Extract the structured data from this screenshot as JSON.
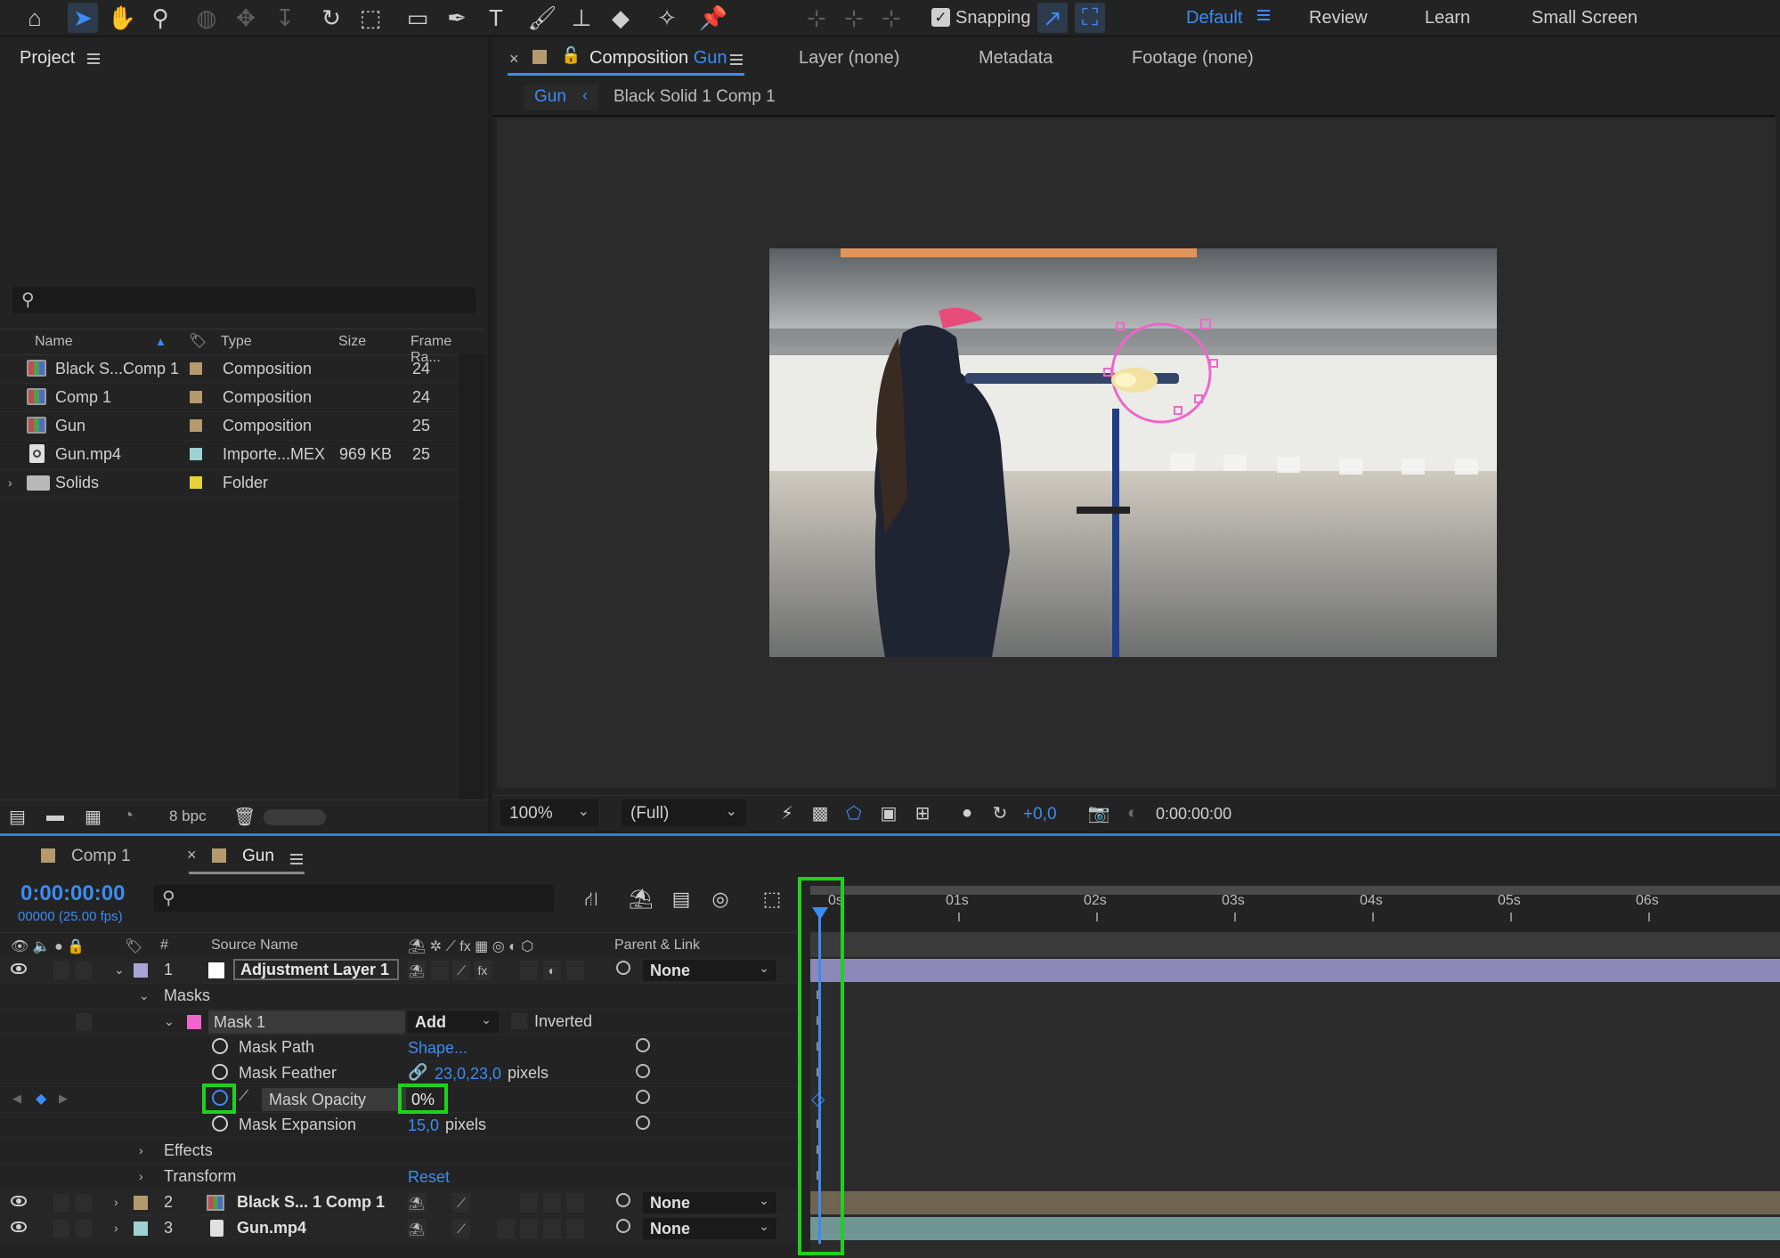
{
  "toolbar": {
    "snapping_label": "Snapping",
    "workspaces": [
      "Default",
      "Review",
      "Learn",
      "Small Screen"
    ],
    "active_workspace": "Default"
  },
  "project": {
    "title": "Project",
    "search_placeholder": "",
    "columns": {
      "name": "Name",
      "type": "Type",
      "size": "Size",
      "frame_rate": "Frame Ra..."
    },
    "items": [
      {
        "name": "Black S...Comp 1",
        "type": "Composition",
        "size": "",
        "frame_rate": "24",
        "icon": "composition-icon",
        "label_color": "#b59a6e"
      },
      {
        "name": "Comp 1",
        "type": "Composition",
        "size": "",
        "frame_rate": "24",
        "icon": "composition-icon",
        "label_color": "#b59a6e"
      },
      {
        "name": "Gun",
        "type": "Composition",
        "size": "",
        "frame_rate": "25",
        "icon": "composition-icon",
        "label_color": "#b59a6e"
      },
      {
        "name": "Gun.mp4",
        "type": "Importe...MEX",
        "size": "969 KB",
        "frame_rate": "25",
        "icon": "footage-icon",
        "label_color": "#9ed2d2"
      },
      {
        "name": "Solids",
        "type": "Folder",
        "size": "",
        "frame_rate": "",
        "icon": "folder-icon",
        "label_color": "#e6d23a"
      }
    ],
    "bit_depth": "8 bpc"
  },
  "composition_panel": {
    "tab_prefix": "Composition",
    "tab_name": "Gun",
    "other_tabs": [
      "Layer (none)",
      "Metadata",
      "Footage (none)"
    ],
    "breadcrumb": [
      "Gun",
      "Black Solid 1 Comp 1"
    ],
    "zoom": "100%",
    "resolution": "(Full)",
    "exposure": "+0,0",
    "timecode": "0:00:00:00"
  },
  "timeline": {
    "tabs": [
      "Comp 1",
      "Gun"
    ],
    "active_tab": "Gun",
    "current_time": "0:00:00:00",
    "frame_info": "00000 (25.00 fps)",
    "columns": {
      "number": "#",
      "source_name": "Source Name",
      "parent": "Parent & Link"
    },
    "ruler_labels": [
      "0s",
      "01s",
      "02s",
      "03s",
      "04s",
      "05s",
      "06s"
    ],
    "layers": [
      {
        "number": "1",
        "name": "Adjustment Layer 1",
        "parent": "None",
        "label_color": "#a9a4d6",
        "swatch_color": "#ffffff",
        "track_color": "#8c88b8"
      },
      {
        "number": "2",
        "name": "Black S... 1 Comp 1",
        "parent": "None",
        "label_color": "#b59a6e",
        "track_color": "#6e6451"
      },
      {
        "number": "3",
        "name": "Gun.mp4",
        "parent": "None",
        "label_color": "#9ed2d2",
        "track_color": "#6f9595"
      }
    ],
    "masks_group": "Masks",
    "mask": {
      "name": "Mask 1",
      "mode": "Add",
      "inverted_label": "Inverted",
      "color": "#ee66cc"
    },
    "properties": {
      "mask_path": {
        "label": "Mask Path",
        "value": "Shape..."
      },
      "mask_feather": {
        "label": "Mask Feather",
        "value": "23,0,23,0",
        "unit": "pixels"
      },
      "mask_opacity": {
        "label": "Mask Opacity",
        "value": "0%"
      },
      "mask_expansion": {
        "label": "Mask Expansion",
        "value": "15,0",
        "unit": "pixels"
      }
    },
    "effects_label": "Effects",
    "transform_label": "Transform",
    "transform_reset": "Reset"
  }
}
